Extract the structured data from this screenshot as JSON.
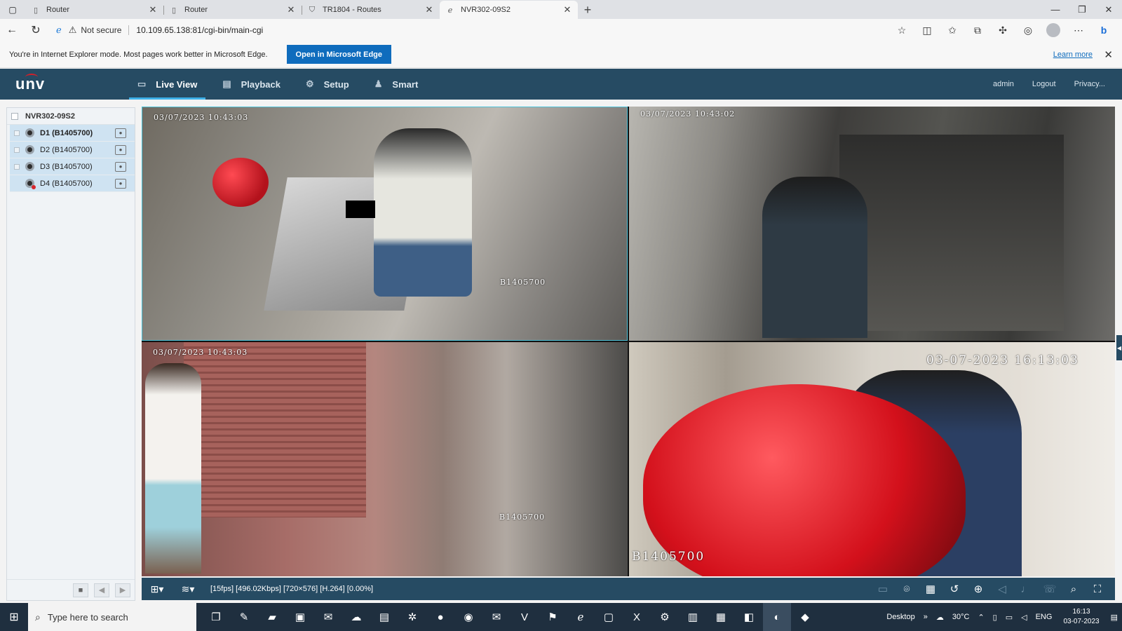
{
  "browser": {
    "tabs": [
      {
        "title": "Router",
        "active": false,
        "icon": "page-icon"
      },
      {
        "title": "Router",
        "active": false,
        "icon": "page-icon"
      },
      {
        "title": "TR1804 - Routes",
        "active": false,
        "icon": "router-icon"
      },
      {
        "title": "NVR302-09S2",
        "active": true,
        "icon": "ie-icon"
      }
    ],
    "address": {
      "security": "Not secure",
      "url": "10.109.65.138:81/cgi-bin/main-cgi"
    },
    "ie_bar": {
      "message": "You're in Internet Explorer mode. Most pages work better in Microsoft Edge.",
      "open_button": "Open in Microsoft Edge",
      "learn_more": "Learn more"
    }
  },
  "nvr": {
    "logo": "unv",
    "nav": [
      {
        "label": "Live View",
        "icon": "monitor-icon",
        "active": true
      },
      {
        "label": "Playback",
        "icon": "film-icon",
        "active": false
      },
      {
        "label": "Setup",
        "icon": "gear-icon",
        "active": false
      },
      {
        "label": "Smart",
        "icon": "person-icon",
        "active": false
      }
    ],
    "user": {
      "name": "admin",
      "logout": "Logout",
      "privacy": "Privacy..."
    },
    "device_tree": {
      "root": "NVR302-09S2",
      "channels": [
        {
          "label": "D1 (B1405700)",
          "selected": true,
          "offline": false
        },
        {
          "label": "D2 (B1405700)",
          "selected": false,
          "offline": false
        },
        {
          "label": "D3 (B1405700)",
          "selected": false,
          "offline": false
        },
        {
          "label": "D4 (B1405700)",
          "selected": false,
          "offline": true
        }
      ]
    },
    "views": [
      {
        "timestamp": "03/07/2023 10:43:03",
        "camera_id": "B1405700"
      },
      {
        "timestamp": "03/07/2023 10:43:02",
        "camera_id": ""
      },
      {
        "timestamp": "03/07/2023 10:43:03",
        "camera_id": "B1405700"
      },
      {
        "timestamp": "03-07-2023 16:13:03",
        "camera_id": "B1405700"
      }
    ],
    "stream_info": "[15fps] [496.02Kbps] [720×576] [H.264] [0.00%]"
  },
  "taskbar": {
    "search_placeholder": "Type here to search",
    "desktop_label": "Desktop",
    "weather": "30°C",
    "language": "ENG",
    "time": "16:13",
    "date": "03-07-2023"
  }
}
